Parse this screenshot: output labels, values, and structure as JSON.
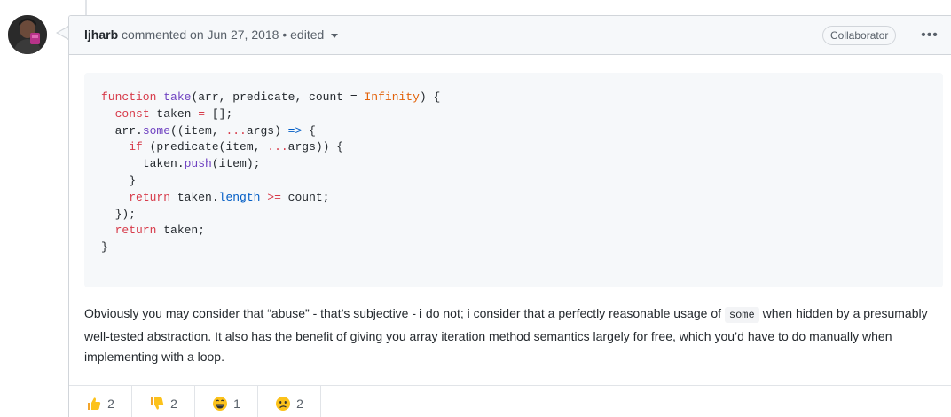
{
  "comment": {
    "author": "ljharb",
    "action_text": " commented on Jun 27, 2018 • edited",
    "role_badge": "Collaborator",
    "more_icon": "kebab-horizontal-icon"
  },
  "code": {
    "language": "javascript",
    "lines": [
      [
        {
          "t": "keyword",
          "v": "function "
        },
        {
          "t": "function",
          "v": "take"
        },
        {
          "t": "plain",
          "v": "(arr, predicate, count = "
        },
        {
          "t": "constant",
          "v": "Infinity"
        },
        {
          "t": "plain",
          "v": ") {"
        }
      ],
      [
        {
          "t": "plain",
          "v": "  "
        },
        {
          "t": "keyword",
          "v": "const"
        },
        {
          "t": "plain",
          "v": " taken "
        },
        {
          "t": "keyword",
          "v": "="
        },
        {
          "t": "plain",
          "v": " [];"
        }
      ],
      [
        {
          "t": "plain",
          "v": "  arr."
        },
        {
          "t": "function",
          "v": "some"
        },
        {
          "t": "plain",
          "v": "((item, "
        },
        {
          "t": "keyword",
          "v": "..."
        },
        {
          "t": "plain",
          "v": "args) "
        },
        {
          "t": "property",
          "v": "=>"
        },
        {
          "t": "plain",
          "v": " {"
        }
      ],
      [
        {
          "t": "plain",
          "v": "    "
        },
        {
          "t": "keyword",
          "v": "if"
        },
        {
          "t": "plain",
          "v": " (predicate(item, "
        },
        {
          "t": "keyword",
          "v": "..."
        },
        {
          "t": "plain",
          "v": "args)) {"
        }
      ],
      [
        {
          "t": "plain",
          "v": "      taken."
        },
        {
          "t": "function",
          "v": "push"
        },
        {
          "t": "plain",
          "v": "(item);"
        }
      ],
      [
        {
          "t": "plain",
          "v": "    }"
        }
      ],
      [
        {
          "t": "plain",
          "v": "    "
        },
        {
          "t": "keyword",
          "v": "return"
        },
        {
          "t": "plain",
          "v": " taken."
        },
        {
          "t": "property",
          "v": "length"
        },
        {
          "t": "plain",
          "v": " "
        },
        {
          "t": "keyword",
          "v": ">="
        },
        {
          "t": "plain",
          "v": " count;"
        }
      ],
      [
        {
          "t": "plain",
          "v": "  });"
        }
      ],
      [
        {
          "t": "plain",
          "v": "  "
        },
        {
          "t": "keyword",
          "v": "return"
        },
        {
          "t": "plain",
          "v": " taken;"
        }
      ],
      [
        {
          "t": "plain",
          "v": "}"
        }
      ]
    ]
  },
  "body": {
    "before_code": "Obviously you may consider that “abuse” - that’s subjective - i do not; i consider that a perfectly reasonable usage of ",
    "inline_code": "some",
    "after_code": " when hidden by a presumably well-tested abstraction. It also has the benefit of giving you array iteration method semantics largely for free, which you’d have to do manually when implementing with a loop."
  },
  "reactions": [
    {
      "icon": "thumbs-up-icon",
      "count": "2"
    },
    {
      "icon": "thumbs-down-icon",
      "count": "2"
    },
    {
      "icon": "laugh-icon",
      "count": "1"
    },
    {
      "icon": "confused-icon",
      "count": "2"
    }
  ],
  "colors": {
    "keyword": "#d73a49",
    "function": "#6f42c1",
    "constant": "#e36209",
    "property": "#005cc5"
  }
}
